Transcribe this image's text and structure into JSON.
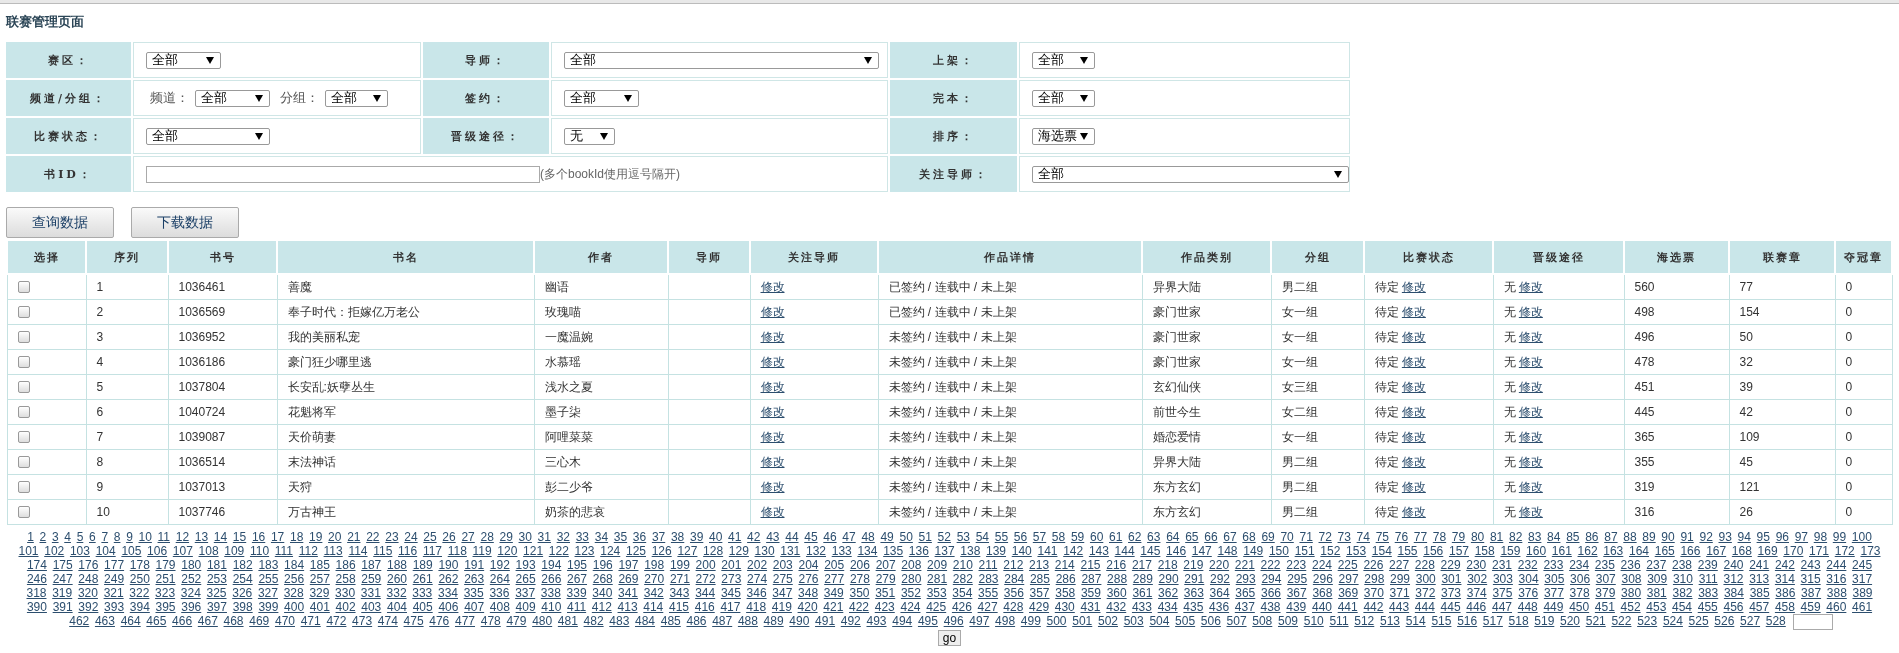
{
  "page_title": "联赛管理页面",
  "filter_rows": [
    {
      "cells": [
        {
          "label": "赛区：",
          "kind": "select",
          "value": "全部"
        },
        {
          "label": "导师：",
          "kind": "select",
          "value": "全部"
        },
        {
          "label": "上架：",
          "kind": "select",
          "value": "全部"
        }
      ]
    },
    {
      "cells": [
        {
          "label": "频道/分组：",
          "kind": "pair",
          "selects": [
            {
              "label": "频道：",
              "value": "全部"
            },
            {
              "label": "分组：",
              "value": "全部"
            }
          ]
        },
        {
          "label": "签约：",
          "kind": "select",
          "value": "全部"
        },
        {
          "label": "完本：",
          "kind": "select",
          "value": "全部"
        }
      ]
    },
    {
      "cells": [
        {
          "label": "比赛状态：",
          "kind": "select",
          "value": "全部"
        },
        {
          "label": "晋级途径：",
          "kind": "select",
          "value": "无"
        },
        {
          "label": "排序：",
          "kind": "select",
          "value": "海选票"
        }
      ]
    },
    {
      "cells": [
        {
          "label": "书ID：",
          "kind": "input",
          "hint": "(多个bookId使用逗号隔开)"
        },
        {
          "label": "关注导师：",
          "kind": "select",
          "value": "全部"
        }
      ]
    }
  ],
  "buttons": [
    "查询数据",
    "下载数据"
  ],
  "columns": [
    "选择",
    "序列",
    "书号",
    "书名",
    "作者",
    "导师",
    "关注导师",
    "作品详情",
    "作品类别",
    "分组",
    "比赛状态",
    "晋级途径",
    "海选票",
    "联赛章",
    "夺冠章"
  ],
  "rows": [
    {
      "checked": false,
      "seq": "1",
      "book_id": "1036461",
      "title": "善魔",
      "author": "幽语",
      "follow_link": "修改",
      "detail": "已签约 / 连载中 / 未上架",
      "category": "异界大陆",
      "group": "男二组",
      "status": "待定",
      "status_link": "修改",
      "promotion": "无",
      "promotion_link": "修改",
      "votes": "560",
      "chapters": "77",
      "champion": "0"
    },
    {
      "checked": false,
      "seq": "2",
      "book_id": "1036569",
      "title": "奉子时代：拒嫁亿万老公",
      "author": "玫瑰喵",
      "follow_link": "修改",
      "detail": "已签约 / 连载中 / 未上架",
      "category": "豪门世家",
      "group": "女一组",
      "status": "待定",
      "status_link": "修改",
      "promotion": "无",
      "promotion_link": "修改",
      "votes": "498",
      "chapters": "154",
      "champion": "0"
    },
    {
      "checked": false,
      "seq": "3",
      "book_id": "1036952",
      "title": "我的美丽私宠",
      "author": "一魔温婉",
      "follow_link": "修改",
      "detail": "未签约 / 连载中 / 未上架",
      "category": "豪门世家",
      "group": "女一组",
      "status": "待定",
      "status_link": "修改",
      "promotion": "无",
      "promotion_link": "修改",
      "votes": "496",
      "chapters": "50",
      "champion": "0"
    },
    {
      "checked": false,
      "seq": "4",
      "book_id": "1036186",
      "title": "豪门狂少哪里逃",
      "author": "水慕瑶",
      "follow_link": "修改",
      "detail": "未签约 / 连载中 / 未上架",
      "category": "豪门世家",
      "group": "女一组",
      "status": "待定",
      "status_link": "修改",
      "promotion": "无",
      "promotion_link": "修改",
      "votes": "478",
      "chapters": "32",
      "champion": "0"
    },
    {
      "checked": false,
      "seq": "5",
      "book_id": "1037804",
      "title": "长安乱:妖孽丛生",
      "author": "浅水之夏",
      "follow_link": "修改",
      "detail": "未签约 / 连载中 / 未上架",
      "category": "玄幻仙侠",
      "group": "女三组",
      "status": "待定",
      "status_link": "修改",
      "promotion": "无",
      "promotion_link": "修改",
      "votes": "451",
      "chapters": "39",
      "champion": "0"
    },
    {
      "checked": false,
      "seq": "6",
      "book_id": "1040724",
      "title": "花魁将军",
      "author": "墨子柒",
      "follow_link": "修改",
      "detail": "未签约 / 连载中 / 未上架",
      "category": "前世今生",
      "group": "女二组",
      "status": "待定",
      "status_link": "修改",
      "promotion": "无",
      "promotion_link": "修改",
      "votes": "445",
      "chapters": "42",
      "champion": "0"
    },
    {
      "checked": false,
      "seq": "7",
      "book_id": "1039087",
      "title": "天价萌妻",
      "author": "阿哩菜菜",
      "follow_link": "修改",
      "detail": "未签约 / 连载中 / 未上架",
      "category": "婚恋爱情",
      "group": "女一组",
      "status": "待定",
      "status_link": "修改",
      "promotion": "无",
      "promotion_link": "修改",
      "votes": "365",
      "chapters": "109",
      "champion": "0"
    },
    {
      "checked": false,
      "seq": "8",
      "book_id": "1036514",
      "title": "末法神话",
      "author": "三心木",
      "follow_link": "修改",
      "detail": "未签约 / 连载中 / 未上架",
      "category": "异界大陆",
      "group": "男二组",
      "status": "待定",
      "status_link": "修改",
      "promotion": "无",
      "promotion_link": "修改",
      "votes": "355",
      "chapters": "45",
      "champion": "0"
    },
    {
      "checked": false,
      "seq": "9",
      "book_id": "1037013",
      "title": "天狩",
      "author": "彭二少爷",
      "follow_link": "修改",
      "detail": "未签约 / 连载中 / 未上架",
      "category": "东方玄幻",
      "group": "男二组",
      "status": "待定",
      "status_link": "修改",
      "promotion": "无",
      "promotion_link": "修改",
      "votes": "319",
      "chapters": "121",
      "champion": "0"
    },
    {
      "checked": false,
      "seq": "10",
      "book_id": "1037746",
      "title": "万古神王",
      "author": "奶茶的悲哀",
      "follow_link": "修改",
      "detail": "未签约 / 连载中 / 未上架",
      "category": "东方玄幻",
      "group": "男二组",
      "status": "待定",
      "status_link": "修改",
      "promotion": "无",
      "promotion_link": "修改",
      "votes": "316",
      "chapters": "26",
      "champion": "0"
    }
  ],
  "pagination": {
    "go_button": "go",
    "pages": [
      "1",
      "2",
      "3",
      "4",
      "5",
      "6",
      "7",
      "8",
      "9",
      "10",
      "11",
      "12",
      "13",
      "14",
      "15",
      "16",
      "17",
      "18",
      "19",
      "20",
      "21",
      "22",
      "23",
      "24",
      "25",
      "26",
      "27",
      "28",
      "29",
      "30",
      "31",
      "32",
      "33",
      "34",
      "35",
      "36",
      "37",
      "38",
      "39",
      "40",
      "41",
      "42",
      "43",
      "44",
      "45",
      "46",
      "47",
      "48",
      "49",
      "50",
      "51",
      "52",
      "53",
      "54",
      "55",
      "56",
      "57",
      "58",
      "59",
      "60",
      "61",
      "62",
      "63",
      "64",
      "65",
      "66",
      "67",
      "68",
      "69",
      "70",
      "71",
      "72",
      "73",
      "74",
      "75",
      "76",
      "77",
      "78",
      "79",
      "80",
      "81",
      "82",
      "83",
      "84",
      "85",
      "86",
      "87",
      "88",
      "89",
      "90",
      "91",
      "92",
      "93",
      "94",
      "95",
      "96",
      "97",
      "98",
      "99",
      "100",
      "101",
      "102",
      "103",
      "104",
      "105",
      "106",
      "107",
      "108",
      "109",
      "110",
      "111",
      "112",
      "113",
      "114",
      "115",
      "116",
      "117",
      "118",
      "119",
      "120",
      "121",
      "122",
      "123",
      "124",
      "125",
      "126",
      "127",
      "128",
      "129",
      "130",
      "131",
      "132",
      "133",
      "134",
      "135",
      "136",
      "137",
      "138",
      "139",
      "140",
      "141",
      "142",
      "143",
      "144",
      "145",
      "146",
      "147",
      "148",
      "149",
      "150",
      "151",
      "152",
      "153",
      "154",
      "155",
      "156",
      "157",
      "158",
      "159",
      "160",
      "161",
      "162",
      "163",
      "164",
      "165",
      "166",
      "167",
      "168",
      "169",
      "170",
      "171",
      "172",
      "173",
      "174",
      "175",
      "176",
      "177",
      "178",
      "179",
      "180",
      "181",
      "182",
      "183",
      "184",
      "185",
      "186",
      "187",
      "188",
      "189",
      "190",
      "191",
      "192",
      "193",
      "194",
      "195",
      "196",
      "197",
      "198",
      "199",
      "200",
      "201",
      "202",
      "203",
      "204",
      "205",
      "206",
      "207",
      "208",
      "209",
      "210",
      "211",
      "212",
      "213",
      "214",
      "215",
      "216",
      "217",
      "218",
      "219",
      "220",
      "221",
      "222",
      "223",
      "224",
      "225",
      "226",
      "227",
      "228",
      "229",
      "230",
      "231",
      "232",
      "233",
      "234",
      "235",
      "236",
      "237",
      "238",
      "239",
      "240",
      "241",
      "242",
      "243",
      "244",
      "245",
      "246",
      "247",
      "248",
      "249",
      "250",
      "251",
      "252",
      "253",
      "254",
      "255",
      "256",
      "257",
      "258",
      "259",
      "260",
      "261",
      "262",
      "263",
      "264",
      "265",
      "266",
      "267",
      "268",
      "269",
      "270",
      "271",
      "272",
      "273",
      "274",
      "275",
      "276",
      "277",
      "278",
      "279",
      "280",
      "281",
      "282",
      "283",
      "284",
      "285",
      "286",
      "287",
      "288",
      "289",
      "290",
      "291",
      "292",
      "293",
      "294",
      "295",
      "296",
      "297",
      "298",
      "299",
      "300",
      "301",
      "302",
      "303",
      "304",
      "305",
      "306",
      "307",
      "308",
      "309",
      "310",
      "311",
      "312",
      "313",
      "314",
      "315",
      "316",
      "317",
      "318",
      "319",
      "320",
      "321",
      "322",
      "323",
      "324",
      "325",
      "326",
      "327",
      "328",
      "329",
      "330",
      "331",
      "332",
      "333",
      "334",
      "335",
      "336",
      "337",
      "338",
      "339",
      "340",
      "341",
      "342",
      "343",
      "344",
      "345",
      "346",
      "347",
      "348",
      "349",
      "350",
      "351",
      "352",
      "353",
      "354",
      "355",
      "356",
      "357",
      "358",
      "359",
      "360",
      "361",
      "362",
      "363",
      "364",
      "365",
      "366",
      "367",
      "368",
      "369",
      "370",
      "371",
      "372",
      "373",
      "374",
      "375",
      "376",
      "377",
      "378",
      "379",
      "380",
      "381",
      "382",
      "383",
      "384",
      "385",
      "386",
      "387",
      "388",
      "389",
      "390",
      "391",
      "392",
      "393",
      "394",
      "395",
      "396",
      "397",
      "398",
      "399",
      "400",
      "401",
      "402",
      "403",
      "404",
      "405",
      "406",
      "407",
      "408",
      "409",
      "410",
      "411",
      "412",
      "413",
      "414",
      "415",
      "416",
      "417",
      "418",
      "419",
      "420",
      "421",
      "422",
      "423",
      "424",
      "425",
      "426",
      "427",
      "428",
      "429",
      "430",
      "431",
      "432",
      "433",
      "434",
      "435",
      "436",
      "437",
      "438",
      "439",
      "440",
      "441",
      "442",
      "443",
      "444",
      "445",
      "446",
      "447",
      "448",
      "449",
      "450",
      "451",
      "452",
      "453",
      "454",
      "455",
      "456",
      "457",
      "458",
      "459",
      "460",
      "461",
      "462",
      "463",
      "464",
      "465",
      "466",
      "467",
      "468",
      "469",
      "470",
      "471",
      "472",
      "473",
      "474",
      "475",
      "476",
      "477",
      "478",
      "479",
      "480",
      "481",
      "482",
      "483",
      "484",
      "485",
      "486",
      "487",
      "488",
      "489",
      "490",
      "491",
      "492",
      "493",
      "494",
      "495",
      "496",
      "497",
      "498",
      "499",
      "500",
      "501",
      "502",
      "503",
      "504",
      "505",
      "506",
      "507",
      "508",
      "509",
      "510",
      "511",
      "512",
      "513",
      "514",
      "515",
      "516",
      "517",
      "518",
      "519",
      "520",
      "521",
      "522",
      "523",
      "524",
      "525",
      "526",
      "527",
      "528"
    ]
  }
}
